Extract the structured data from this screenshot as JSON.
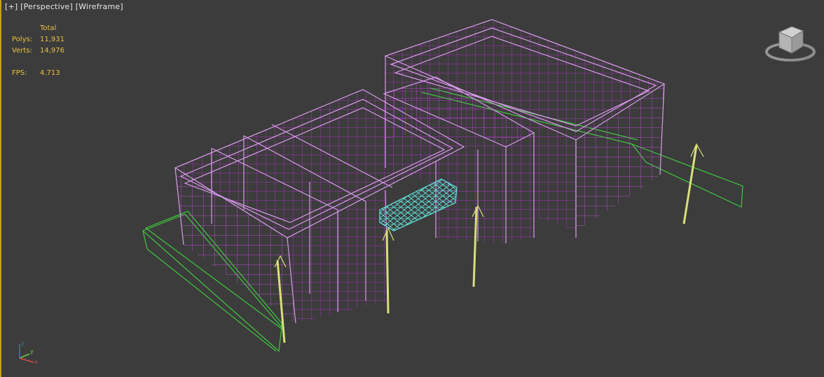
{
  "viewport": {
    "menu": {
      "plus": "[+]",
      "view": "[Perspective]",
      "shading": "[Wireframe]"
    },
    "stats": {
      "header": "Total",
      "polys_label": "Polys:",
      "polys_value": "11,931",
      "verts_label": "Verts:",
      "verts_value": "14,976",
      "fps_label": "FPS:",
      "fps_value": "4.713"
    },
    "axis": {
      "x": "x",
      "y": "y",
      "z": "z"
    },
    "colors": {
      "background": "#3c3c3c",
      "building_wire": "#b030c8",
      "building_wire_light": "#d79be8",
      "selected_glass": "#5fd8d0",
      "ground_wire": "#3fc83f",
      "light_poles": "#d8e078",
      "stats_text": "#e8c040",
      "active_border": "#c8a020"
    }
  }
}
